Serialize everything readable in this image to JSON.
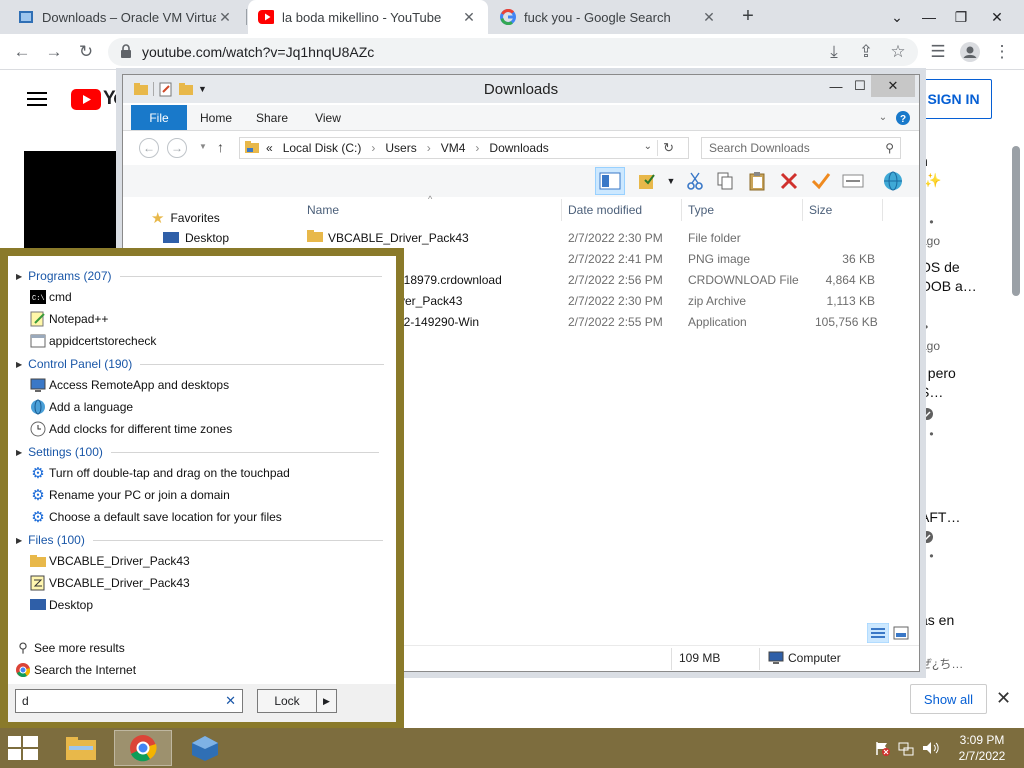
{
  "browser": {
    "tabs": [
      {
        "title": "Downloads – Oracle VM VirtualB",
        "icon": "virtualbox-icon",
        "active": false
      },
      {
        "title": "la boda mikellino - YouTube",
        "icon": "youtube-icon",
        "active": true
      },
      {
        "title": "fuck you - Google Search",
        "icon": "google-icon",
        "active": false
      }
    ],
    "url": "youtube.com/watch?v=Jq1hnqU8AZc"
  },
  "youtube": {
    "logo_text": "Yo",
    "sign_in": "SIGN IN",
    "side_texts": [
      "n",
      "s •",
      "ago",
      "OS de",
      "OOB a…",
      "•",
      "ago",
      "t pero",
      "S…",
      "s •",
      "AFT…",
      "s •",
      "as en",
      "ぜ¿ち…"
    ],
    "show_all": "Show all"
  },
  "explorer": {
    "title": "Downloads",
    "ribbon_tabs": [
      "File",
      "Home",
      "Share",
      "View"
    ],
    "breadcrumb": [
      "«",
      "Local Disk (C:)",
      "›",
      "Users",
      "›",
      "VM4",
      "›",
      "Downloads"
    ],
    "search_placeholder": "Search Downloads",
    "nav": {
      "favorites": "Favorites",
      "desktop": "Desktop"
    },
    "columns": {
      "name": "Name",
      "date": "Date modified",
      "type": "Type",
      "size": "Size"
    },
    "files": [
      {
        "name": "VBCABLE_Driver_Pack43",
        "date": "2/7/2022 2:30 PM",
        "type": "File folder",
        "size": ""
      },
      {
        "name": "",
        "date": "2/7/2022 2:41 PM",
        "type": "PNG image",
        "size": "36 KB"
      },
      {
        "name": "518979.crdownload",
        "date": "2/7/2022 2:56 PM",
        "type": "CRDOWNLOAD File",
        "size": "4,864 KB"
      },
      {
        "name": "ver_Pack43",
        "date": "2/7/2022 2:30 PM",
        "type": "zip Archive",
        "size": "1,113 KB"
      },
      {
        "name": "32-149290-Win",
        "date": "2/7/2022 2:55 PM",
        "type": "Application",
        "size": "105,756 KB"
      }
    ],
    "status": {
      "size": "109 MB",
      "location": "Computer"
    }
  },
  "search_results": {
    "groups": [
      {
        "label": "Programs (207)",
        "items": [
          "cmd",
          "Notepad++",
          "appidcertstorecheck"
        ]
      },
      {
        "label": "Control Panel (190)",
        "items": [
          "Access RemoteApp and desktops",
          "Add a language",
          "Add clocks for different time zones"
        ]
      },
      {
        "label": "Settings (100)",
        "items": [
          "Turn off double-tap and drag on the touchpad",
          "Rename your PC or join a domain",
          "Choose a default save location for your files"
        ]
      },
      {
        "label": "Files (100)",
        "items": [
          "VBCABLE_Driver_Pack43",
          "VBCABLE_Driver_Pack43",
          "Desktop"
        ]
      }
    ],
    "see_more": "See more results",
    "search_internet": "Search the Internet",
    "query": "d",
    "lock_label": "Lock"
  },
  "taskbar": {
    "time": "3:09 PM",
    "date": "2/7/2022"
  },
  "colors": {
    "taskbar": "#7d6d3e",
    "accent": "#1979ca",
    "youtube_red": "#ff0000",
    "link_blue": "#065fd4"
  }
}
